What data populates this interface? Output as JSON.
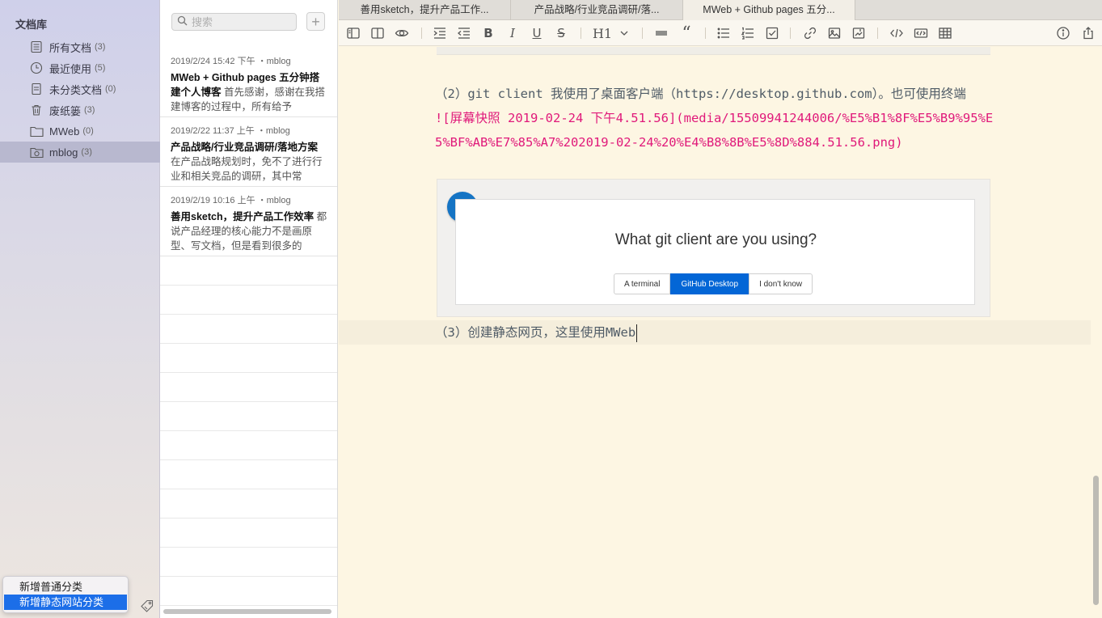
{
  "sidebar": {
    "title": "文档库",
    "items": [
      {
        "label": "所有文档",
        "count": "(3)",
        "icon": "docs-icon"
      },
      {
        "label": "最近使用",
        "count": "(5)",
        "icon": "clock-icon"
      },
      {
        "label": "未分类文档",
        "count": "(0)",
        "icon": "doc-icon"
      },
      {
        "label": "废纸篓",
        "count": "(3)",
        "icon": "trash-icon"
      },
      {
        "label": "MWeb",
        "count": "(0)",
        "icon": "folder-icon"
      },
      {
        "label": "mblog",
        "count": "(3)",
        "icon": "site-folder-icon",
        "selected": true
      }
    ],
    "context_menu": {
      "items": [
        "新增普通分类",
        "新增静态网站分类"
      ],
      "highlighted": "新增静态网站分类"
    }
  },
  "notelist": {
    "search_placeholder": "搜索",
    "add_label": "+",
    "notes": [
      {
        "meta": "2019/2/24 15:42 下午 ・mblog",
        "title": "MWeb + Github pages 五分钟搭建个人博客",
        "snippet": " 首先感谢，感谢在我搭建博客的过程中，所有给予"
      },
      {
        "meta": "2019/2/22 11:37 上午 ・mblog",
        "title": "产品战略/行业竞品调研/落地方案",
        "snippet": " 在产品战略规划时，免不了进行行业和相关竞品的调研，其中常"
      },
      {
        "meta": "2019/2/19 10:16 上午 ・mblog",
        "title": "善用sketch，提升产品工作效率",
        "snippet": " 都说产品经理的核心能力不是画原型、写文档，但是看到很多的"
      }
    ]
  },
  "tabs": [
    {
      "label": "善用sketch，提升产品工作..."
    },
    {
      "label": "产品战略/行业竞品调研/落..."
    },
    {
      "label": "MWeb + Github pages 五分...",
      "active": true
    }
  ],
  "toolbar": {
    "heading_label": "H1"
  },
  "editor": {
    "para2": "（2）git client 我使用了桌面客户端（https://desktop.github.com）。也可使用终端",
    "image_markdown": "![屏幕快照 2019-02-24 下午4.51.56](media/15509941244006/%E5%B1%8F%E5%B9%95%E5%BF%AB%E7%85%A7%202019-02-24%20%E4%B8%8B%E5%8D%884.51.56.png)",
    "image": {
      "question_mark": "?",
      "question": "What git client are you using?",
      "choices": [
        "A terminal",
        "GitHub Desktop",
        "I don't know"
      ],
      "selected_choice": "GitHub Desktop"
    },
    "para3": "（3）创建静态网页，这里使用MWeb"
  },
  "colors": {
    "sidebar_selected": "#b8b8cf",
    "editor_bg": "#fdf6e3",
    "markdown_link": "#e0197a",
    "menu_highlight": "#1c6ee8",
    "github_blue": "#0366d6"
  }
}
